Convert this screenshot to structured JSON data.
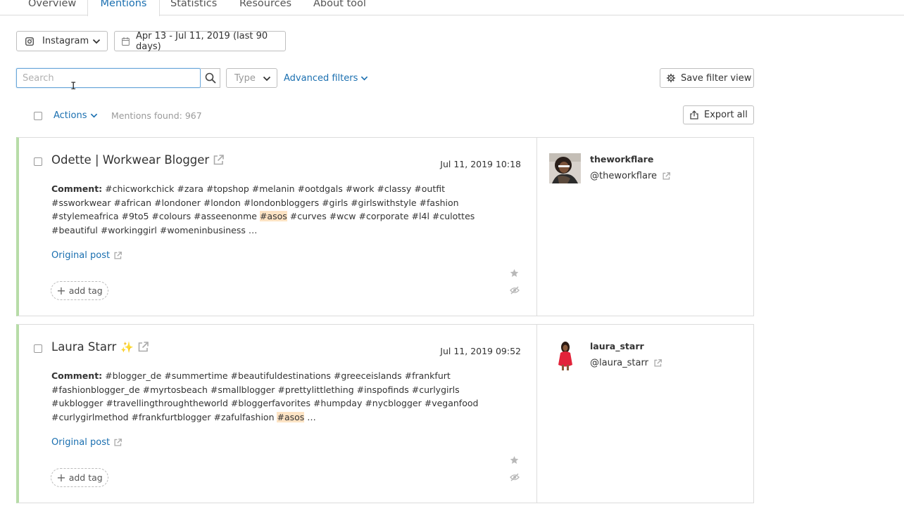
{
  "tabs": [
    {
      "label": "Overview"
    },
    {
      "label": "Mentions"
    },
    {
      "label": "Statistics"
    },
    {
      "label": "Resources"
    },
    {
      "label": "About tool"
    }
  ],
  "filters": {
    "platform": "Instagram",
    "date_range": "Apr 13 - Jul 11, 2019 (last 90 days)",
    "search_placeholder": "Search",
    "search_value": "",
    "type_placeholder": "Type",
    "advanced_filters": "Advanced filters",
    "save_filter_view": "Save filter view"
  },
  "toolbar": {
    "actions": "Actions",
    "mentions_found": "Mentions found: 967",
    "export_all": "Export all"
  },
  "mentions": [
    {
      "author": "Odette | Workwear Blogger",
      "date": "Jul 11, 2019 10:18",
      "comment_label": "Comment:",
      "comment_before": "#chicworkchick #zara #topshop #melanin #ootdgals #work #classy #outfit #ssworkwear #african #londoner #london #londonbloggers #girls #girlswithstyle #fashion #stylemeafrica #9to5 #colours #asseenonme ",
      "comment_highlight": "#asos",
      "comment_after": " #curves #wcw #corporate #l4l #culottes #beautiful #workinggirl #womeninbusiness …",
      "original_post": "Original post",
      "add_tag": "add tag",
      "account_name": "theworkflare",
      "account_handle": "@theworkflare"
    },
    {
      "author": "Laura Starr",
      "author_emoji": "✨",
      "date": "Jul 11, 2019 09:52",
      "comment_label": "Comment:",
      "comment_before": "#blogger_de #summertime #beautifuldestinations #greeceislands #frankfurt #fashionblogger_de #myrtosbeach #smallblogger #prettylittlething #inspofinds #curlygirls #ukblogger #travellingthroughtheworld #bloggerfavorites #humpday #nycblogger #veganfood #curlygirlmethod #frankfurtblogger #zafulfashion ",
      "comment_highlight": "#asos",
      "comment_after": " …",
      "original_post": "Original post",
      "add_tag": "add tag",
      "account_name": "laura_starr",
      "account_handle": "@laura_starr"
    }
  ],
  "colors": {
    "accent": "#1a6fb0",
    "card_stripe": "#b7dca8",
    "highlight": "#fde3c4"
  }
}
